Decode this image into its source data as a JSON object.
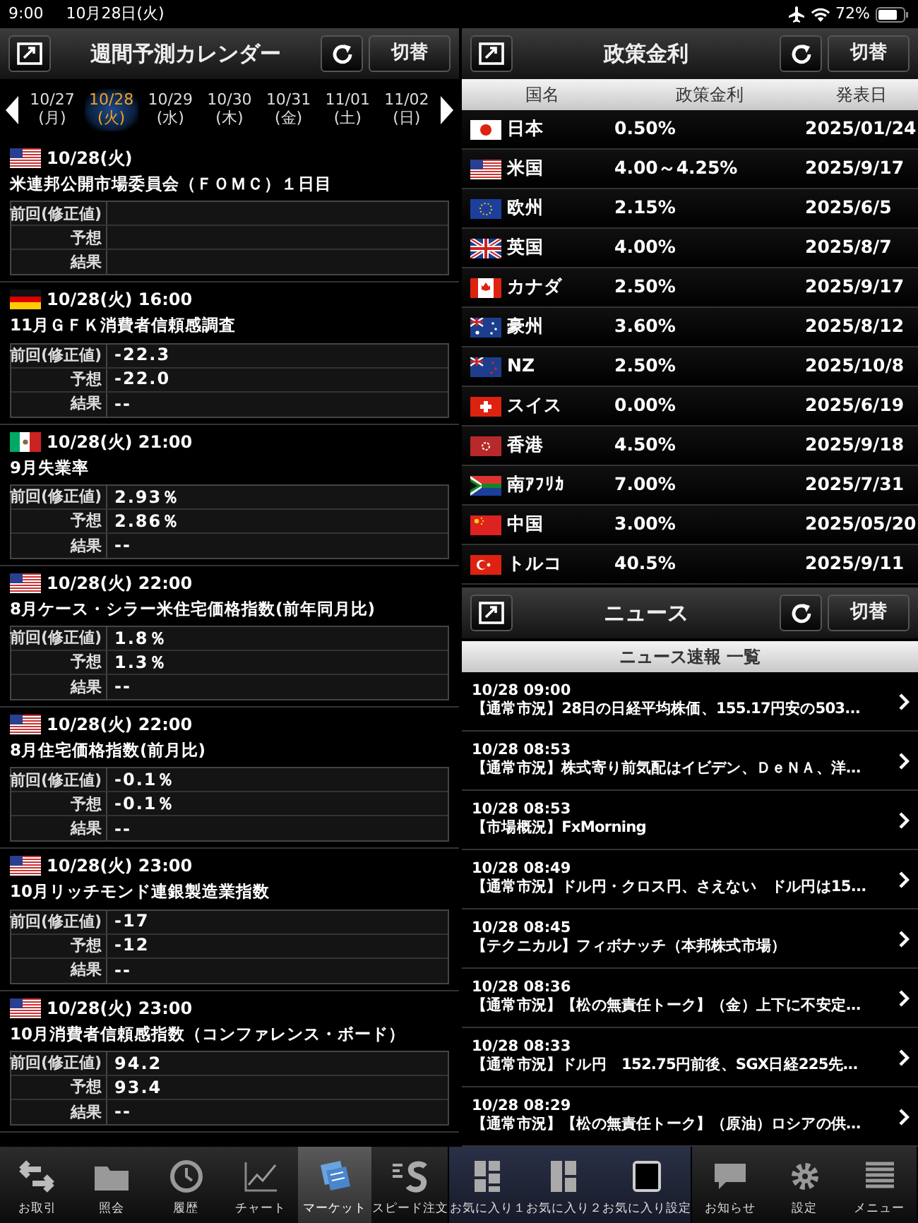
{
  "status_bar": {
    "time": "9:00",
    "date": "10月28日(火)",
    "battery": "72%"
  },
  "calendar": {
    "title": "週間予測カレンダー",
    "switch_button": "切替",
    "days": [
      {
        "date": "10/27",
        "weekday": "(月)",
        "selected": false
      },
      {
        "date": "10/28",
        "weekday": "(火)",
        "selected": true
      },
      {
        "date": "10/29",
        "weekday": "(水)",
        "selected": false
      },
      {
        "date": "10/30",
        "weekday": "(木)",
        "selected": false
      },
      {
        "date": "10/31",
        "weekday": "(金)",
        "selected": false
      },
      {
        "date": "11/01",
        "weekday": "(土)",
        "selected": false
      },
      {
        "date": "11/02",
        "weekday": "(日)",
        "selected": false
      }
    ],
    "events": [
      {
        "kind": "us",
        "datetime": "10/28(火)",
        "title": "米連邦公開市場委員会（ＦＯＭＣ）１日目",
        "rows": [
          {
            "label": "前回(修正値)"
          },
          {
            "label": "予想"
          },
          {
            "label": "結果"
          }
        ]
      },
      {
        "kind": "de",
        "datetime": "10/28(火) 16:00",
        "title": "11月ＧＦＫ消費者信頼感調査",
        "rows": [
          {
            "label": "前回(修正値)",
            "figure": "-22.3"
          },
          {
            "label": "予想",
            "figure": "-22.0"
          },
          {
            "label": "結果",
            "figure": "--"
          }
        ]
      },
      {
        "kind": "mx",
        "datetime": "10/28(火) 21:00",
        "title": "9月失業率",
        "rows": [
          {
            "label": "前回(修正値)",
            "figure": "2.93％"
          },
          {
            "label": "予想",
            "figure": "2.86％"
          },
          {
            "label": "結果",
            "figure": "--"
          }
        ]
      },
      {
        "kind": "us",
        "datetime": "10/28(火) 22:00",
        "title": "8月ケース・シラー米住宅価格指数(前年同月比)",
        "rows": [
          {
            "label": "前回(修正値)",
            "figure": "1.8％"
          },
          {
            "label": "予想",
            "figure": "1.3％"
          },
          {
            "label": "結果",
            "figure": "--"
          }
        ]
      },
      {
        "kind": "us",
        "datetime": "10/28(火) 22:00",
        "title": "8月住宅価格指数(前月比)",
        "rows": [
          {
            "label": "前回(修正値)",
            "figure": "-0.1％"
          },
          {
            "label": "予想",
            "figure": "-0.1％"
          },
          {
            "label": "結果",
            "figure": "--"
          }
        ]
      },
      {
        "kind": "us",
        "datetime": "10/28(火) 23:00",
        "title": "10月リッチモンド連銀製造業指数",
        "rows": [
          {
            "label": "前回(修正値)",
            "figure": "-17"
          },
          {
            "label": "予想",
            "figure": "-12"
          },
          {
            "label": "結果",
            "figure": "--"
          }
        ]
      },
      {
        "kind": "us",
        "datetime": "10/28(火) 23:00",
        "title": "10月消費者信頼感指数（コンファレンス・ボード）",
        "rows": [
          {
            "label": "前回(修正値)",
            "figure": "94.2"
          },
          {
            "label": "予想",
            "figure": "93.4"
          },
          {
            "label": "結果",
            "figure": "--"
          }
        ]
      }
    ]
  },
  "policy_rates": {
    "title": "政策金利",
    "switch_button": "切替",
    "columns": [
      "国名",
      "政策金利",
      "発表日"
    ],
    "rows": [
      {
        "kind": "jp",
        "country": "日本",
        "rate": "0.50%",
        "date": "2025/01/24"
      },
      {
        "kind": "us",
        "country": "米国",
        "rate": "4.00～4.25%",
        "date": "2025/9/17"
      },
      {
        "kind": "eu",
        "country": "欧州",
        "rate": "2.15%",
        "date": "2025/6/5"
      },
      {
        "kind": "gb",
        "country": "英国",
        "rate": "4.00%",
        "date": "2025/8/7"
      },
      {
        "kind": "ca",
        "country": "カナダ",
        "rate": "2.50%",
        "date": "2025/9/17"
      },
      {
        "kind": "au",
        "country": "豪州",
        "rate": "3.60%",
        "date": "2025/8/12"
      },
      {
        "kind": "nz",
        "country": "NZ",
        "rate": "2.50%",
        "date": "2025/10/8"
      },
      {
        "kind": "ch",
        "country": "スイス",
        "rate": "0.00%",
        "date": "2025/6/19"
      },
      {
        "kind": "hk",
        "country": "香港",
        "rate": "4.50%",
        "date": "2025/9/18"
      },
      {
        "kind": "za",
        "country": "南ｱﾌﾘｶ",
        "rate": "7.00%",
        "date": "2025/7/31"
      },
      {
        "kind": "cn",
        "country": "中国",
        "rate": "3.00%",
        "date": "2025/05/20"
      },
      {
        "kind": "tr",
        "country": "トルコ",
        "rate": "40.5%",
        "date": "2025/9/11"
      }
    ]
  },
  "news": {
    "title": "ニュース",
    "switch_button": "切替",
    "subtitle": "ニュース速報 一覧",
    "items": [
      {
        "time": "10/28 09:00",
        "title": "【通常市況】28日の日経平均株価、155.17円安の503..."
      },
      {
        "time": "10/28 08:53",
        "title": "【通常市況】株式寄り前気配はイビデン、ＤｅＮＡ、洋…"
      },
      {
        "time": "10/28 08:53",
        "title": "【市場概況】FxMorning"
      },
      {
        "time": "10/28 08:49",
        "title": "【通常市況】ドル円・クロス円、さえない　ドル円は15..."
      },
      {
        "time": "10/28 08:45",
        "title": "【テクニカル】フィボナッチ（本邦株式市場）"
      },
      {
        "time": "10/28 08:36",
        "title": "【通常市況】【松の無責任トーク】（金）上下に不安定…"
      },
      {
        "time": "10/28 08:33",
        "title": "【通常市況】ドル円　152.75円前後、SGX日経225先…"
      },
      {
        "time": "10/28 08:29",
        "title": "【通常市況】【松の無責任トーク】（原油）ロシアの供…"
      }
    ]
  },
  "tab_bar": {
    "sections": [
      {
        "highlighted": false,
        "items": [
          {
            "label": "お取引",
            "selected": false
          },
          {
            "label": "照会",
            "selected": false
          },
          {
            "label": "履歴",
            "selected": false
          },
          {
            "label": "チャート",
            "selected": false
          },
          {
            "label": "マーケット",
            "selected": true
          },
          {
            "label": "スピード注文",
            "selected": false
          }
        ]
      },
      {
        "highlighted": true,
        "items": [
          {
            "label": "お気に入り１",
            "selected": false
          },
          {
            "label": "お気に入り２",
            "selected": false
          },
          {
            "label": "お気に入り設定",
            "selected": false
          }
        ]
      },
      {
        "highlighted": false,
        "items": [
          {
            "label": "お知らせ",
            "selected": false
          },
          {
            "label": "設定",
            "selected": false
          },
          {
            "label": "メニュー",
            "selected": false
          }
        ]
      }
    ]
  }
}
